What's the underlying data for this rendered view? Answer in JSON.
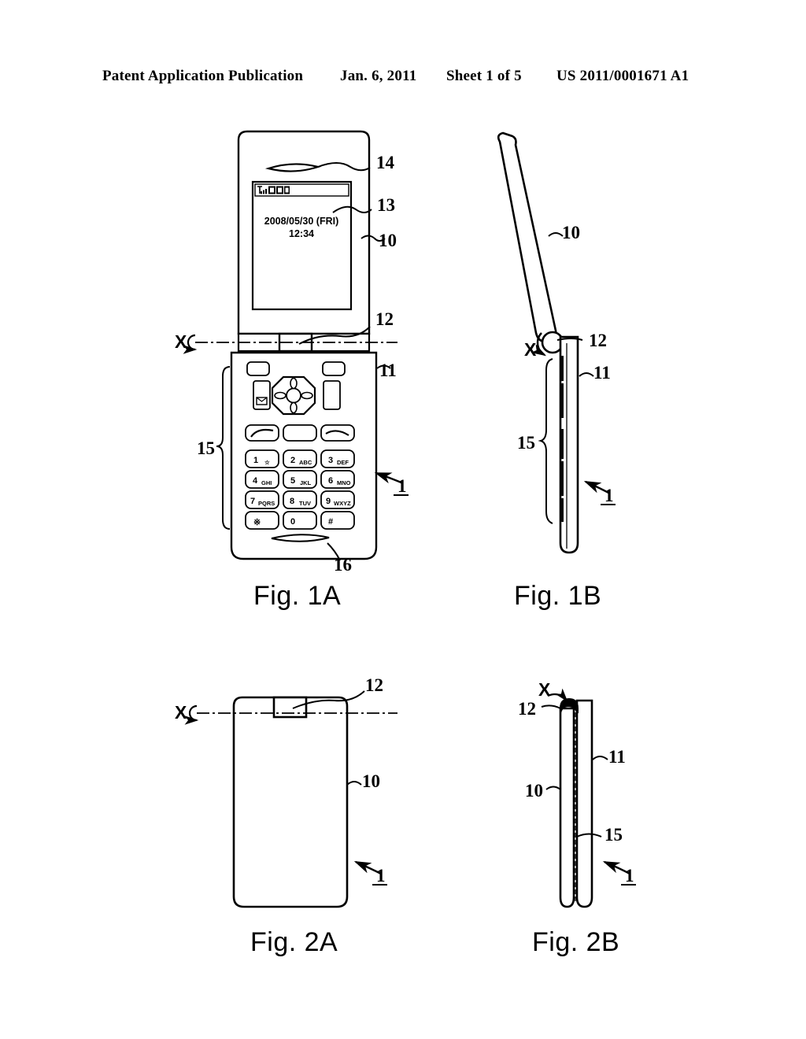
{
  "header": {
    "publication": "Patent Application Publication",
    "date": "Jan. 6, 2011",
    "sheet": "Sheet 1 of 5",
    "patent_number": "US 2011/0001671 A1"
  },
  "figures": [
    {
      "id": "fig-1a",
      "caption": "Fig. 1A"
    },
    {
      "id": "fig-1b",
      "caption": "Fig. 1B"
    },
    {
      "id": "fig-2a",
      "caption": "Fig. 2A"
    },
    {
      "id": "fig-2b",
      "caption": "Fig. 2B"
    }
  ],
  "fig1a": {
    "display": {
      "date_line": "2008/05/30 (FRI)",
      "time_line": "12:34",
      "status_icons": [
        "signal-strength-icon",
        "indicator-icons"
      ]
    },
    "reference_numerals": {
      "speaker": "14",
      "display": "13",
      "upper_housing": "10",
      "hinge": "12",
      "lower_housing": "11",
      "operation_keys": "15",
      "microphone": "16",
      "device": "1",
      "axis": "X"
    },
    "keypad": [
      {
        "num": "1",
        "letters": "☆"
      },
      {
        "num": "2",
        "letters": "ABC"
      },
      {
        "num": "3",
        "letters": "DEF"
      },
      {
        "num": "4",
        "letters": "GHI"
      },
      {
        "num": "5",
        "letters": "JKL"
      },
      {
        "num": "6",
        "letters": "MNO"
      },
      {
        "num": "7",
        "letters": "PQRS"
      },
      {
        "num": "8",
        "letters": "TUV"
      },
      {
        "num": "9",
        "letters": "WXYZ"
      },
      {
        "num": "※",
        "letters": ""
      },
      {
        "num": "0",
        "letters": ""
      },
      {
        "num": "#",
        "letters": ""
      }
    ],
    "function_keys": [
      "mail-key",
      "dpad-key",
      "soft-key-left",
      "soft-key-right",
      "call-key",
      "center-key",
      "end-key"
    ]
  },
  "fig1b": {
    "reference_numerals": {
      "upper_housing": "10",
      "hinge": "12",
      "lower_housing": "11",
      "operation_keys": "15",
      "device": "1",
      "axis": "X"
    }
  },
  "fig2a": {
    "reference_numerals": {
      "hinge": "12",
      "upper_housing": "10",
      "device": "1",
      "axis": "X"
    }
  },
  "fig2b": {
    "reference_numerals": {
      "hinge": "12",
      "upper_housing": "10",
      "lower_housing": "11",
      "operation_keys": "15",
      "device": "1",
      "axis": "X"
    }
  },
  "colors": {
    "ink": "#000000",
    "paper": "#ffffff"
  }
}
